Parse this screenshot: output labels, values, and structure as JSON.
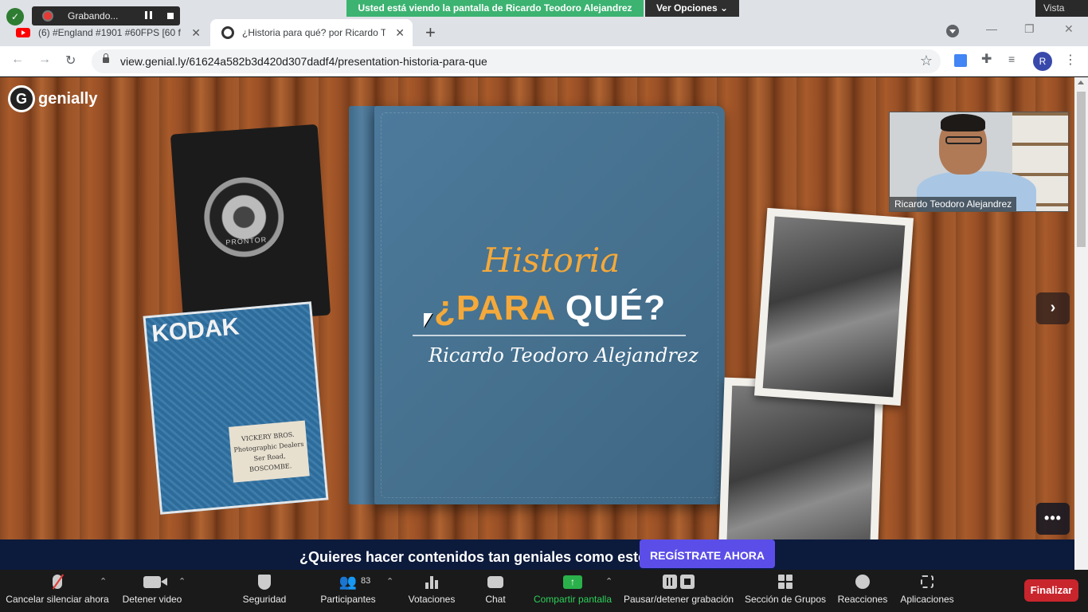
{
  "recording": {
    "label": "Grabando..."
  },
  "share_banner": {
    "text": "Usted está viendo la pantalla de Ricardo Teodoro Alejandrez",
    "options_label": "Ver Opciones ⌄",
    "view_label": "Vista"
  },
  "tabs": [
    {
      "title": "(6) #England #1901 #60FPS [60 f",
      "icon": "youtube-icon"
    },
    {
      "title": "¿Historia para qué? por Ricardo T",
      "icon": "genially-icon",
      "active": true
    }
  ],
  "address_bar": {
    "url": "view.genial.ly/61624a582b3d420d307dadf4/presentation-historia-para-que",
    "profile_initial": "R"
  },
  "slide": {
    "brand": "genially",
    "title_script": "Historia",
    "title_main_orange": "¿PARA",
    "title_main_white": "QUÉ?",
    "author": "Ricardo Teodoro Alejandrez",
    "camera_brand": "PRONTOR",
    "booklet_title": "KODAK",
    "booklet_card": [
      "VICKERY BROS.",
      "Photographic Dealers",
      "Ser Road,",
      "BOSCOMBE."
    ]
  },
  "video_tile": {
    "name": "Ricardo Teodoro Alejandrez"
  },
  "promo": {
    "text": "¿Quieres hacer contenidos tan geniales como este?",
    "button": "REGÍSTRATE AHORA"
  },
  "zoom_toolbar": {
    "mute": "Cancelar silenciar ahora",
    "video": "Detener video",
    "security": "Seguridad",
    "participants": "Participantes",
    "participants_count": "83",
    "polls": "Votaciones",
    "chat": "Chat",
    "share": "Compartir pantalla",
    "recording": "Pausar/detener grabación",
    "breakout": "Sección de Grupos",
    "reactions": "Reacciones",
    "apps": "Aplicaciones",
    "end": "Finalizar"
  }
}
